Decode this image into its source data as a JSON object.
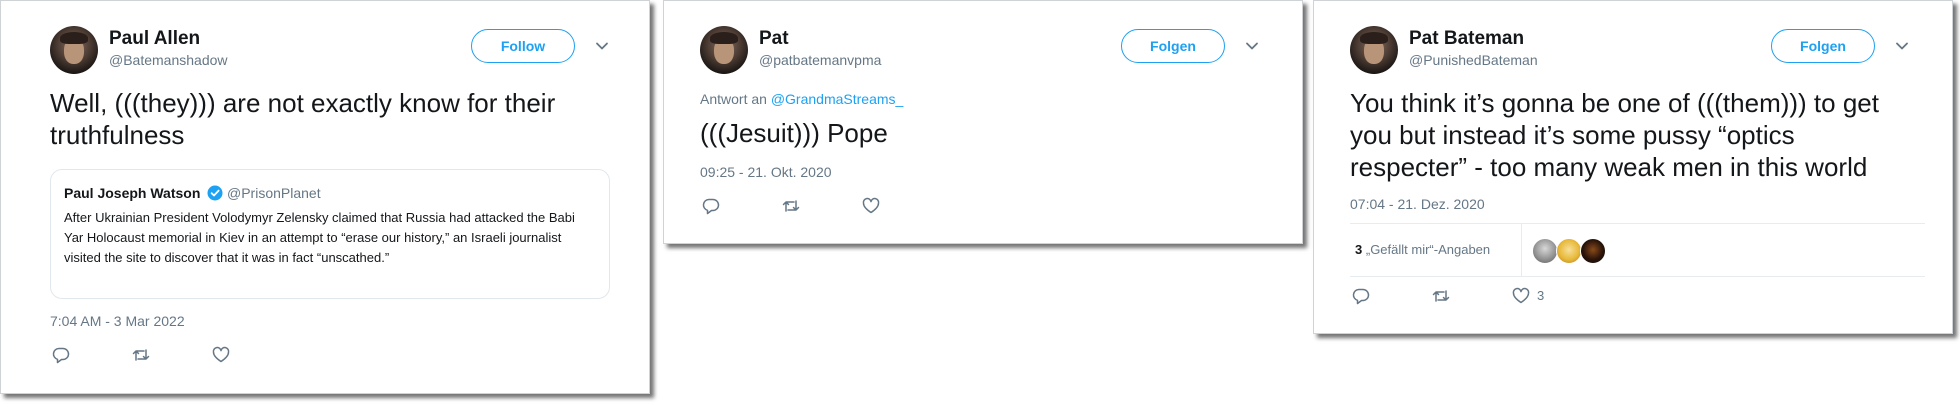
{
  "tweets": [
    {
      "author_name": "Paul Allen",
      "author_handle": "@Batemanshadow",
      "follow_label": "Follow",
      "text": "Well, (((they))) are not exactly know for their truthfulness",
      "quote": {
        "author_name": "Paul Joseph Watson",
        "author_handle": "@PrisonPlanet",
        "verified_icon": "verified-badge-icon",
        "text": "After Ukrainian President Volodymyr Zelensky claimed that Russia had attacked the Babi Yar Holocaust memorial in Kiev in an attempt to “erase our history,” an Israeli journalist visited the site to discover that it was in fact “unscathed.”"
      },
      "timestamp": "7:04 AM - 3 Mar 2022"
    },
    {
      "author_name": "Pat",
      "author_handle": "@patbatemanvpma",
      "follow_label": "Folgen",
      "reply_prefix": "Antwort an",
      "reply_handle": "@GrandmaStreams_",
      "text": "(((Jesuit))) Pope",
      "timestamp": "09:25 - 21. Okt. 2020"
    },
    {
      "author_name": "Pat Bateman",
      "author_handle": "@PunishedBateman",
      "follow_label": "Folgen",
      "text": "You think it’s gonna be one of (((them))) to get you but instead it’s some pussy “optics respecter” - too many weak men in this world",
      "timestamp": "07:04 - 21. Dez. 2020",
      "likes_count": "3",
      "likes_label": "„Gefällt mir“-Angaben",
      "like_action_count": "3"
    }
  ],
  "icons": {
    "reply": "reply-icon",
    "retweet": "retweet-icon",
    "like": "heart-icon",
    "more": "chevron-down-icon"
  },
  "colors": {
    "accent": "#1da1f2",
    "secondary_text": "#657786",
    "primary_text": "#14171a"
  }
}
